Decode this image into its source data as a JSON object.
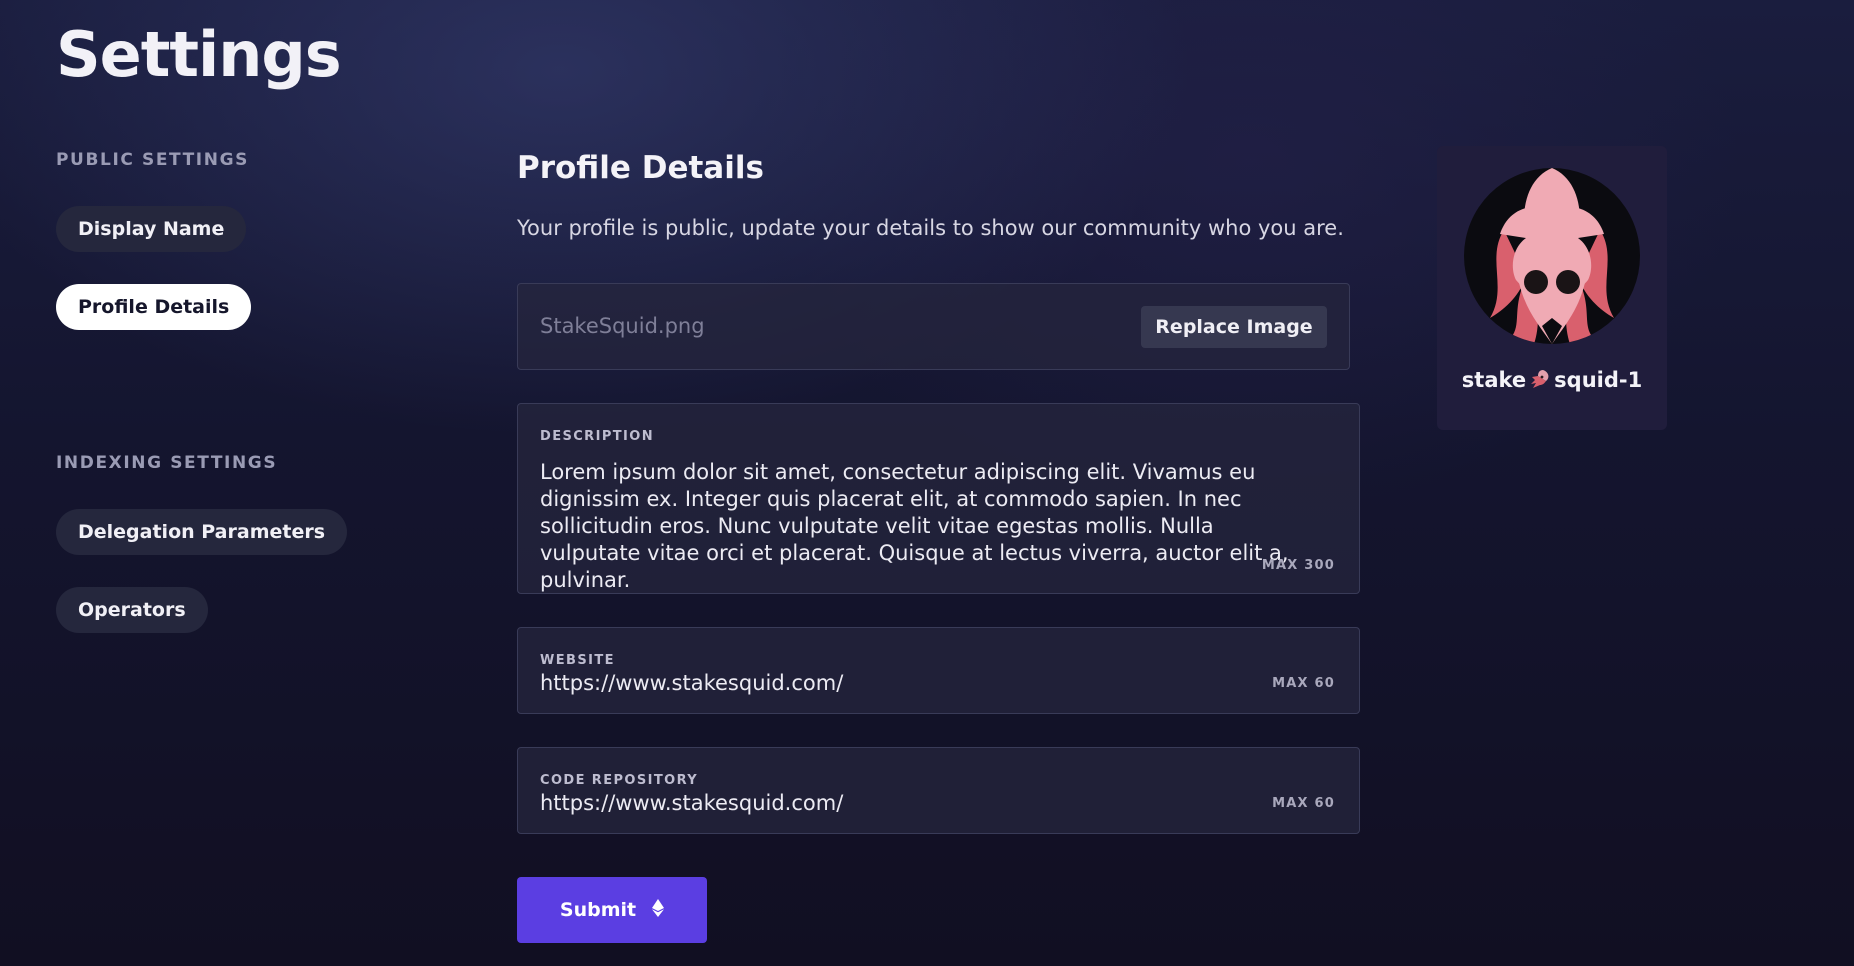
{
  "page": {
    "title": "Settings"
  },
  "sidebar": {
    "public_label": "PUBLIC SETTINGS",
    "indexing_label": "INDEXING SETTINGS",
    "items": [
      {
        "label": "Display Name",
        "active": false
      },
      {
        "label": "Profile Details",
        "active": true
      },
      {
        "label": "Delegation Parameters",
        "active": false
      },
      {
        "label": "Operators",
        "active": false
      }
    ]
  },
  "panel": {
    "title": "Profile Details",
    "subtitle": "Your profile is public, update your details to show our community who you are.",
    "image": {
      "filename": "StakeSquid.png",
      "button_label": "Replace Image"
    },
    "description": {
      "label": "DESCRIPTION",
      "value": "Lorem ipsum dolor sit amet, consectetur adipiscing elit. Vivamus eu dignissim ex. Integer quis placerat elit, at commodo sapien. In nec sollicitudin eros. Nunc vulputate velit vitae egestas mollis. Nulla vulputate vitae orci et placerat. Quisque at lectus viverra, auctor elit a, pulvinar.",
      "max": "MAX 300"
    },
    "website": {
      "label": "WEBSITE",
      "value": "https://www.stakesquid.com/",
      "max": "MAX 60"
    },
    "repository": {
      "label": "CODE REPOSITORY",
      "value": "https://www.stakesquid.com/",
      "max": "MAX 60"
    },
    "submit_label": "Submit",
    "submit_icon": "ethereum-icon"
  },
  "profile": {
    "name_left": "stake",
    "name_right": "squid-1",
    "emoji_icon": "squid-emoji-icon",
    "avatar_icon": "squid-avatar"
  },
  "colors": {
    "accent": "#5b3ee2",
    "squid_pink": "#f0aab4",
    "squid_dark_pink": "#d9606d",
    "card_bg": "#201d3c"
  }
}
